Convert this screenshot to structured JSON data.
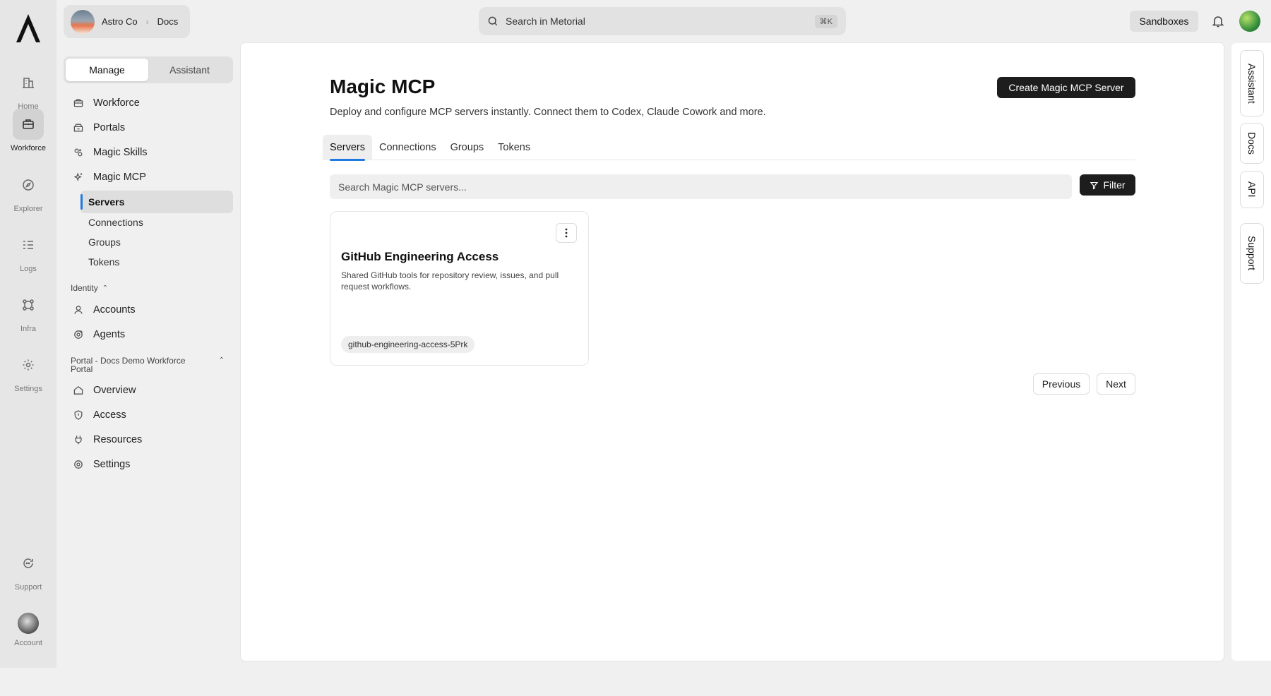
{
  "rail": {
    "items": [
      {
        "label": "Home",
        "icon": "building-icon"
      },
      {
        "label": "Workforce",
        "icon": "briefcase-icon"
      },
      {
        "label": "Explorer",
        "icon": "compass-icon"
      },
      {
        "label": "Logs",
        "icon": "list-icon"
      },
      {
        "label": "Infra",
        "icon": "nodes-icon"
      },
      {
        "label": "Settings",
        "icon": "gear-icon"
      }
    ],
    "support": "Support",
    "account": "Account"
  },
  "org": {
    "name": "Astro Co",
    "page": "Docs"
  },
  "mode": {
    "manage": "Manage",
    "assistant": "Assistant"
  },
  "nav": {
    "workforce": "Workforce",
    "portals": "Portals",
    "magic_skills": "Magic Skills",
    "magic_mcp": "Magic MCP",
    "sub": [
      "Servers",
      "Connections",
      "Groups",
      "Tokens"
    ],
    "identity_header": "Identity",
    "accounts": "Accounts",
    "agents": "Agents",
    "portal_header": "Portal - Docs Demo Workforce Portal",
    "overview": "Overview",
    "access": "Access",
    "resources": "Resources",
    "settings": "Settings"
  },
  "topbar": {
    "search_placeholder": "Search in Metorial",
    "shortcut": "⌘K",
    "sandboxes": "Sandboxes"
  },
  "main": {
    "title": "Magic MCP",
    "description": "Deploy and configure MCP servers instantly. Connect them to Codex, Claude Cowork and more.",
    "create_button": "Create Magic MCP Server",
    "tabs": [
      "Servers",
      "Connections",
      "Groups",
      "Tokens"
    ],
    "search_placeholder": "Search Magic MCP servers...",
    "filter_button": "Filter",
    "cards": [
      {
        "title": "GitHub Engineering Access",
        "description": "Shared GitHub tools for repository review, issues, and pull request workflows.",
        "slug": "github-engineering-access-5Prk"
      }
    ],
    "previous": "Previous",
    "next": "Next"
  },
  "right_rail": [
    "Assistant",
    "Docs",
    "API",
    "Support"
  ],
  "colors": {
    "accent": "#1f7ae0",
    "dark_button": "#1d1d1d"
  }
}
